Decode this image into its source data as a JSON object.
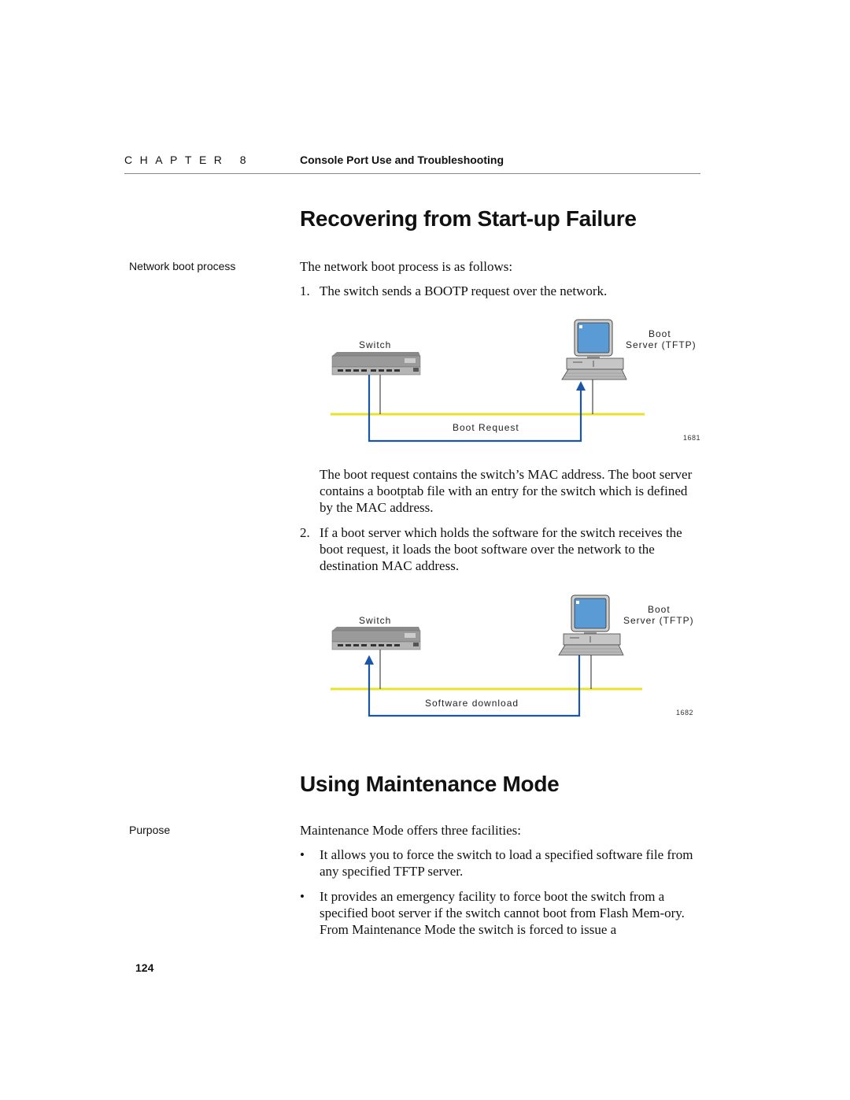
{
  "header": {
    "chapter_label": "CHAPTER 8",
    "chapter_title": "Console Port Use and Troubleshooting"
  },
  "section1": {
    "heading": "Recovering from Start-up Failure",
    "side_label": "Network boot process",
    "intro": "The network boot process is as follows:",
    "step1_num": "1.",
    "step1_text": "The switch sends a BOOTP request over the network.",
    "figure1": {
      "switch_label": "Switch",
      "server_label_line1": "Boot",
      "server_label_line2": "Server (TFTP)",
      "flow_label": "Boot Request",
      "figure_number": "1681"
    },
    "para_after_fig1": "The boot request contains the switch’s MAC address. The boot server contains a bootptab file with an entry for the switch which is defined by the MAC address.",
    "step2_num": "2.",
    "step2_text": "If a boot server which holds the software for the switch receives the boot request, it loads the boot software over the network to the destination MAC address.",
    "figure2": {
      "switch_label": "Switch",
      "server_label_line1": "Boot",
      "server_label_line2": "Server (TFTP)",
      "flow_label": "Software download",
      "figure_number": "1682"
    }
  },
  "section2": {
    "heading": "Using Maintenance Mode",
    "side_label": "Purpose",
    "intro": "Maintenance Mode offers three facilities:",
    "bullets": [
      "It allows you to force the switch to load a specified software file from any specified TFTP server.",
      "It provides an emergency facility to force boot the switch from a specified boot server if the switch cannot boot from Flash Mem-ory. From Maintenance Mode the switch is forced to issue a"
    ],
    "bullet_glyph": "•"
  },
  "footer": {
    "page_number": "124"
  },
  "colors": {
    "network_line": "#e8e22a",
    "flow_line": "#1c55a8",
    "screen": "#5b9bd5"
  }
}
